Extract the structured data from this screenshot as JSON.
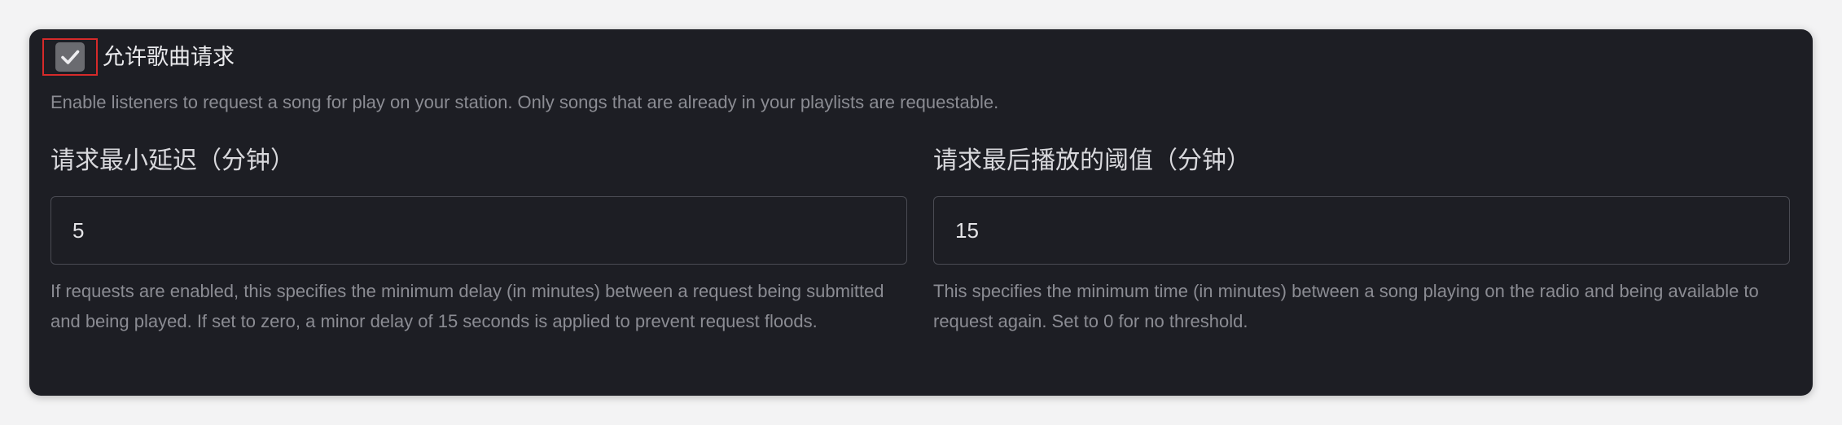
{
  "request_toggle": {
    "label": "允许歌曲请求",
    "checked": true,
    "description": "Enable listeners to request a song for play on your station. Only songs that are already in your playlists are requestable."
  },
  "min_delay": {
    "label": "请求最小延迟（分钟）",
    "value": "5",
    "help": "If requests are enabled, this specifies the minimum delay (in minutes) between a request being submitted and being played. If set to zero, a minor delay of 15 seconds is applied to prevent request floods."
  },
  "threshold": {
    "label": "请求最后播放的阈值（分钟）",
    "value": "15",
    "help": "This specifies the minimum time (in minutes) between a song playing on the radio and being available to request again. Set to 0 for no threshold."
  },
  "icons": {
    "checkbox": "check-icon"
  },
  "colors": {
    "panel_bg": "#1d1e24",
    "page_bg": "#f3f3f4",
    "highlight_border": "#d62a2a",
    "checkbox_fill": "#6a6b70"
  }
}
